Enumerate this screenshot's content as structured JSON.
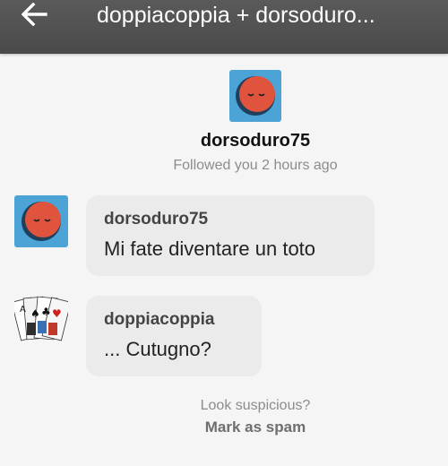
{
  "appbar": {
    "title": "doppiacoppia + dorsoduro..."
  },
  "profile": {
    "username": "dorsoduro75",
    "followed_text": "Followed you 2 hours ago"
  },
  "messages": [
    {
      "sender": "dorsoduro75",
      "text": "Mi fate diventare un toto"
    },
    {
      "sender": "doppiacoppia",
      "text": "... Cutugno?"
    }
  ],
  "spam": {
    "question": "Look suspicious?",
    "link": "Mark as spam"
  },
  "colors": {
    "appbar": "#4f4f4f",
    "avatar_bg": "#4ba3d6",
    "avatar_face": "#e0533d",
    "bubble": "#ebebeb"
  },
  "icons": {
    "back": "arrow-left-icon",
    "avatar": "sleepy-face-avatar",
    "cards": "playing-cards-avatar"
  }
}
